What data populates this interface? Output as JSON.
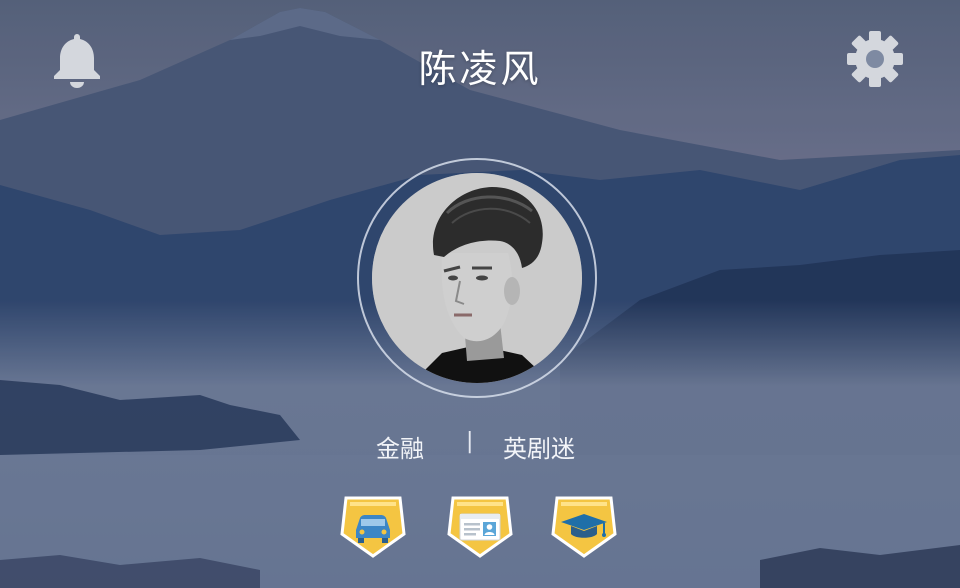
{
  "header": {
    "title": "陈凌风",
    "notification_icon": "bell-icon",
    "settings_icon": "gear-icon"
  },
  "profile": {
    "avatar": "user-portrait",
    "tags": [
      "金融",
      "英剧迷"
    ],
    "separator": "|"
  },
  "badges": [
    {
      "icon": "car-icon",
      "name": "car-badge"
    },
    {
      "icon": "id-card-icon",
      "name": "id-card-badge"
    },
    {
      "icon": "graduation-cap-icon",
      "name": "education-badge"
    }
  ],
  "colors": {
    "badge_fill": "#f4c542",
    "badge_border": "#ffffff",
    "badge_icon": "#3c86c6",
    "title_text": "#ffffff",
    "icon_gray": "#d4d7dd"
  }
}
